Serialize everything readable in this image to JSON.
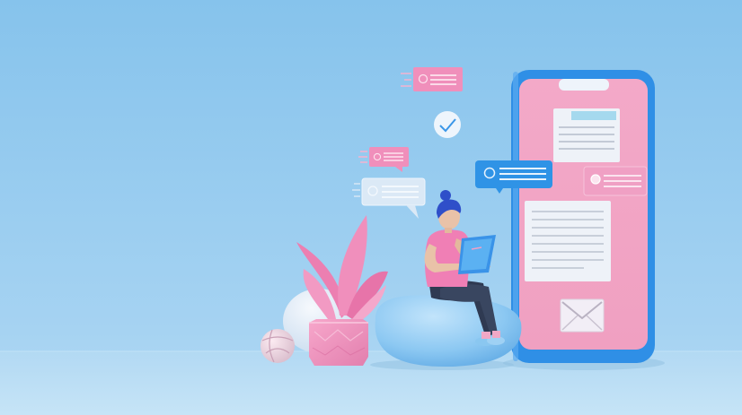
{
  "scene": {
    "subject": "person-reading-tablet-on-beanbag",
    "colors": {
      "background_top": "#8fc8ee",
      "background_bottom": "#aad6f3",
      "floor": "#b9def5",
      "accent_pink": "#f2a6c8",
      "accent_blue": "#2f93e6",
      "phone_frame": "#2f8fe6",
      "card_white": "#eef4fb"
    },
    "icons": [
      "smartphone-icon",
      "chat-bubble-icon",
      "check-icon",
      "envelope-icon",
      "document-icon",
      "plant-icon",
      "ball-icon"
    ]
  }
}
